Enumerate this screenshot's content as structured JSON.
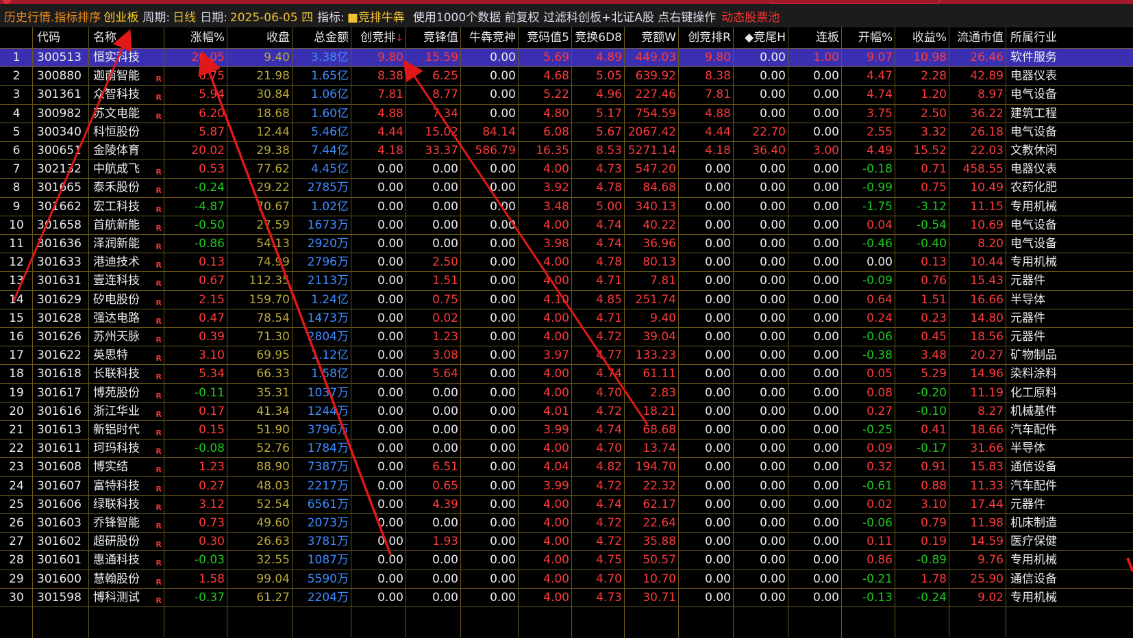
{
  "titlebar": {
    "title": "历史行情.指标排序",
    "board": "创业板",
    "period_label": "周期:",
    "period": "日线",
    "date_label": "日期:",
    "date": "2025-06-05 四",
    "indicator_label": "指标:",
    "indicator": "■竞排牛犇",
    "info": "使用1000个数据 前复权 过滤科创板+北证A股 点右键操作",
    "pool": "动态股票池"
  },
  "columns": [
    "",
    "代码",
    "名称",
    "涨幅%",
    "收盘",
    "总金额",
    "创竞排",
    "竞锋值",
    "牛犇竞神",
    "竞码值5",
    "竞换6D8",
    "竞额W",
    "创竞排R",
    "◆竞尾H",
    "连板",
    "开幅%",
    "收益%",
    "流通市值",
    "所属行业"
  ],
  "sort_indicator": "↓",
  "colors": {
    "selected_row": "#3a2fb0",
    "up": "#ff3a3a",
    "down": "#1ec81e",
    "price": "#b8a838",
    "amount": "#3f8cff",
    "annotation_arrow": "#e01818"
  },
  "rows": [
    [
      "1",
      "300513",
      "恒实科技",
      "",
      "20.05",
      "9.40",
      "3.38亿",
      "9.80",
      "15.59",
      "0.00",
      "5.69",
      "4.89",
      "449.03",
      "9.80",
      "0.00",
      "1.00",
      "9.07",
      "10.98",
      "26.46",
      "软件服务"
    ],
    [
      "2",
      "300880",
      "迦南智能",
      "R",
      "6.75",
      "21.98",
      "1.65亿",
      "8.38",
      "6.25",
      "0.00",
      "4.68",
      "5.05",
      "639.92",
      "8.38",
      "0.00",
      "0.00",
      "4.47",
      "2.28",
      "42.89",
      "电器仪表"
    ],
    [
      "3",
      "301361",
      "众智科技",
      "R",
      "5.94",
      "30.84",
      "1.06亿",
      "7.81",
      "8.77",
      "0.00",
      "5.22",
      "4.96",
      "227.46",
      "7.81",
      "0.00",
      "0.00",
      "4.74",
      "1.20",
      "8.97",
      "电气设备"
    ],
    [
      "4",
      "300982",
      "苏文电能",
      "R",
      "6.20",
      "18.68",
      "1.60亿",
      "4.88",
      "7.34",
      "0.00",
      "4.80",
      "5.17",
      "754.59",
      "4.88",
      "0.00",
      "0.00",
      "3.75",
      "2.50",
      "36.22",
      "建筑工程"
    ],
    [
      "5",
      "300340",
      "科恒股份",
      "",
      "5.87",
      "12.44",
      "5.46亿",
      "4.44",
      "15.02",
      "84.14",
      "6.08",
      "5.67",
      "2067.42",
      "4.44",
      "22.70",
      "0.00",
      "2.55",
      "3.32",
      "26.18",
      "电气设备"
    ],
    [
      "6",
      "300651",
      "金陵体育",
      "",
      "20.02",
      "29.38",
      "7.44亿",
      "4.18",
      "33.37",
      "586.79",
      "16.35",
      "8.53",
      "5271.14",
      "4.18",
      "36.40",
      "3.00",
      "4.49",
      "15.52",
      "22.03",
      "文教休闲"
    ],
    [
      "7",
      "302132",
      "中航成飞",
      "R",
      "0.53",
      "77.62",
      "4.45亿",
      "0.00",
      "0.00",
      "0.00",
      "4.00",
      "4.73",
      "547.20",
      "0.00",
      "0.00",
      "0.00",
      "-0.18",
      "0.71",
      "458.55",
      "电器仪表"
    ],
    [
      "8",
      "301665",
      "泰禾股份",
      "R",
      "-0.24",
      "29.22",
      "2785万",
      "0.00",
      "0.00",
      "0.00",
      "3.92",
      "4.78",
      "84.68",
      "0.00",
      "0.00",
      "0.00",
      "-0.99",
      "0.75",
      "10.49",
      "农药化肥"
    ],
    [
      "9",
      "301662",
      "宏工科技",
      "R",
      "-4.87",
      "70.67",
      "1.02亿",
      "0.00",
      "0.00",
      "0.00",
      "3.48",
      "5.00",
      "340.13",
      "0.00",
      "0.00",
      "0.00",
      "-1.75",
      "-3.12",
      "11.15",
      "专用机械"
    ],
    [
      "10",
      "301658",
      "首航新能",
      "R",
      "-0.50",
      "27.59",
      "1673万",
      "0.00",
      "0.00",
      "0.00",
      "4.00",
      "4.74",
      "40.22",
      "0.00",
      "0.00",
      "0.00",
      "0.04",
      "-0.54",
      "10.69",
      "电气设备"
    ],
    [
      "11",
      "301636",
      "泽润新能",
      "R",
      "-0.86",
      "54.13",
      "2920万",
      "0.00",
      "0.00",
      "0.00",
      "3.98",
      "4.74",
      "36.96",
      "0.00",
      "0.00",
      "0.00",
      "-0.46",
      "-0.40",
      "8.20",
      "电气设备"
    ],
    [
      "12",
      "301633",
      "港迪技术",
      "R",
      "0.13",
      "74.99",
      "2796万",
      "0.00",
      "2.50",
      "0.00",
      "4.00",
      "4.78",
      "80.13",
      "0.00",
      "0.00",
      "0.00",
      "0.00",
      "0.13",
      "10.44",
      "专用机械"
    ],
    [
      "13",
      "301631",
      "壹连科技",
      "R",
      "0.67",
      "112.35",
      "2113万",
      "0.00",
      "1.51",
      "0.00",
      "4.00",
      "4.71",
      "7.81",
      "0.00",
      "0.00",
      "0.00",
      "-0.09",
      "0.76",
      "15.43",
      "元器件"
    ],
    [
      "14",
      "301629",
      "矽电股份",
      "R",
      "2.15",
      "159.70",
      "1.24亿",
      "0.00",
      "0.75",
      "0.00",
      "4.10",
      "4.85",
      "251.74",
      "0.00",
      "0.00",
      "0.00",
      "0.64",
      "1.51",
      "16.66",
      "半导体"
    ],
    [
      "15",
      "301628",
      "强达电路",
      "R",
      "0.47",
      "78.54",
      "1473万",
      "0.00",
      "0.02",
      "0.00",
      "4.00",
      "4.71",
      "9.40",
      "0.00",
      "0.00",
      "0.00",
      "0.24",
      "0.23",
      "14.80",
      "元器件"
    ],
    [
      "16",
      "301626",
      "苏州天脉",
      "R",
      "0.39",
      "71.30",
      "2804万",
      "0.00",
      "1.23",
      "0.00",
      "4.00",
      "4.72",
      "39.04",
      "0.00",
      "0.00",
      "0.00",
      "-0.06",
      "0.45",
      "18.56",
      "元器件"
    ],
    [
      "17",
      "301622",
      "英思特",
      "R",
      "3.10",
      "69.95",
      "1.12亿",
      "0.00",
      "3.08",
      "0.00",
      "3.97",
      "4.77",
      "133.23",
      "0.00",
      "0.00",
      "0.00",
      "-0.38",
      "3.48",
      "20.27",
      "矿物制品"
    ],
    [
      "18",
      "301618",
      "长联科技",
      "R",
      "5.34",
      "66.33",
      "1.58亿",
      "0.00",
      "5.64",
      "0.00",
      "4.00",
      "4.74",
      "61.11",
      "0.00",
      "0.00",
      "0.00",
      "0.05",
      "5.29",
      "14.96",
      "染料涂料"
    ],
    [
      "19",
      "301617",
      "博苑股份",
      "R",
      "-0.11",
      "35.31",
      "1037万",
      "0.00",
      "0.00",
      "0.00",
      "4.00",
      "4.70",
      "2.83",
      "0.00",
      "0.00",
      "0.00",
      "0.08",
      "-0.20",
      "11.19",
      "化工原料"
    ],
    [
      "20",
      "301616",
      "浙江华业",
      "R",
      "0.17",
      "41.34",
      "1244万",
      "0.00",
      "0.00",
      "0.00",
      "4.01",
      "4.72",
      "18.21",
      "0.00",
      "0.00",
      "0.00",
      "0.27",
      "-0.10",
      "8.27",
      "机械基件"
    ],
    [
      "21",
      "301613",
      "新铝时代",
      "R",
      "0.15",
      "51.90",
      "3796万",
      "0.00",
      "0.00",
      "0.00",
      "3.99",
      "4.74",
      "68.68",
      "0.00",
      "0.00",
      "0.00",
      "-0.25",
      "0.41",
      "18.66",
      "汽车配件"
    ],
    [
      "22",
      "301611",
      "珂玛科技",
      "R",
      "-0.08",
      "52.76",
      "1784万",
      "0.00",
      "0.00",
      "0.00",
      "4.00",
      "4.70",
      "13.74",
      "0.00",
      "0.00",
      "0.00",
      "0.09",
      "-0.17",
      "31.66",
      "半导体"
    ],
    [
      "23",
      "301608",
      "博实结",
      "R",
      "1.23",
      "88.90",
      "7387万",
      "0.00",
      "6.51",
      "0.00",
      "4.04",
      "4.82",
      "194.70",
      "0.00",
      "0.00",
      "0.00",
      "0.32",
      "0.91",
      "15.83",
      "通信设备"
    ],
    [
      "24",
      "301607",
      "富特科技",
      "R",
      "0.27",
      "48.03",
      "2217万",
      "0.00",
      "0.65",
      "0.00",
      "3.99",
      "4.72",
      "22.32",
      "0.00",
      "0.00",
      "0.00",
      "-0.61",
      "0.88",
      "11.33",
      "汽车配件"
    ],
    [
      "25",
      "301606",
      "绿联科技",
      "R",
      "3.12",
      "52.54",
      "6561万",
      "0.00",
      "4.39",
      "0.00",
      "4.00",
      "4.74",
      "62.17",
      "0.00",
      "0.00",
      "0.00",
      "0.02",
      "3.10",
      "17.44",
      "元器件"
    ],
    [
      "26",
      "301603",
      "乔锋智能",
      "R",
      "0.73",
      "49.60",
      "2073万",
      "0.00",
      "0.00",
      "0.00",
      "4.00",
      "4.72",
      "22.64",
      "0.00",
      "0.00",
      "0.00",
      "-0.06",
      "0.79",
      "11.98",
      "机床制造"
    ],
    [
      "27",
      "301602",
      "超研股份",
      "R",
      "0.30",
      "26.63",
      "3781万",
      "0.00",
      "1.93",
      "0.00",
      "4.00",
      "4.72",
      "35.88",
      "0.00",
      "0.00",
      "0.00",
      "0.11",
      "0.19",
      "14.59",
      "医疗保健"
    ],
    [
      "28",
      "301601",
      "惠通科技",
      "R",
      "-0.03",
      "32.55",
      "1087万",
      "0.00",
      "0.00",
      "0.00",
      "4.00",
      "4.75",
      "50.57",
      "0.00",
      "0.00",
      "0.00",
      "0.86",
      "-0.89",
      "9.76",
      "专用机械"
    ],
    [
      "29",
      "301600",
      "慧翰股份",
      "R",
      "1.58",
      "99.04",
      "5590万",
      "0.00",
      "0.00",
      "0.00",
      "4.00",
      "4.70",
      "10.70",
      "0.00",
      "0.00",
      "0.00",
      "-0.21",
      "1.78",
      "25.90",
      "通信设备"
    ],
    [
      "30",
      "301598",
      "博科测试",
      "R",
      "-0.37",
      "61.27",
      "2204万",
      "0.00",
      "0.00",
      "0.00",
      "4.00",
      "4.73",
      "30.71",
      "0.00",
      "0.00",
      "0.00",
      "-0.13",
      "-0.24",
      "9.02",
      "专用机械"
    ]
  ]
}
